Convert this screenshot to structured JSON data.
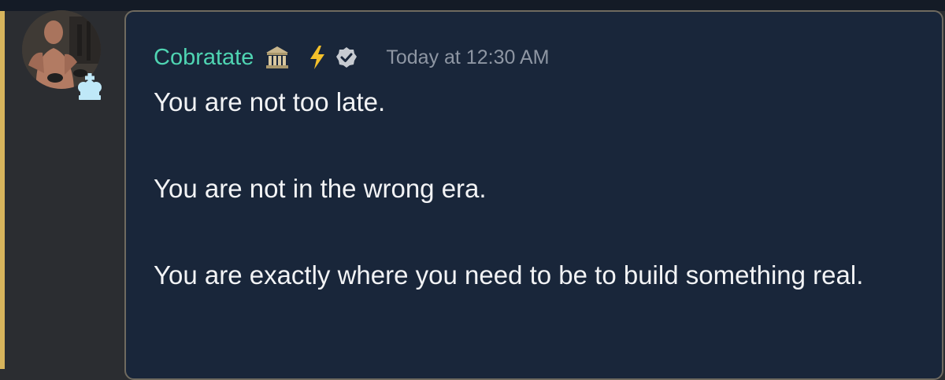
{
  "message": {
    "author": "Cobratate",
    "timestamp": "Today at 12:30 AM",
    "author_badges": [
      "bank-building-icon",
      "lightning-bolt-icon",
      "verified-check-icon"
    ],
    "avatar_badge": "chess-king-icon",
    "paragraphs": [
      "You are not too late.",
      "You are not in the wrong era.",
      "You are exactly where you need to be to build something real."
    ]
  },
  "colors": {
    "username": "#4fd4b2",
    "card_background": "#19263a",
    "accent_bar": "#d7b45c",
    "timestamp": "#8e96a3"
  }
}
